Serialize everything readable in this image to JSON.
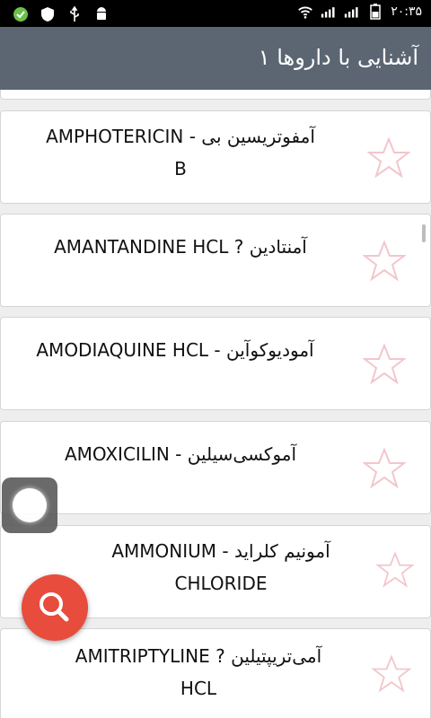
{
  "status_bar": {
    "time": "۲۰:۳۵"
  },
  "app_bar": {
    "title": "آشنایی با داروها ۱"
  },
  "drugs": [
    {
      "line1": "آمفوتریسین بی - AMPHOTERICIN",
      "line2": "B"
    },
    {
      "line1": "آمنتادین ? AMANTANDINE HCL",
      "line2": ""
    },
    {
      "line1": "آمودیوکوآین - AMODIAQUINE HCL",
      "line2": ""
    },
    {
      "line1": "آموکسی‌سیلین - AMOXICILIN",
      "line2": ""
    },
    {
      "line1": "آمونیم کلراید - AMMONIUM",
      "line2": "CHLORIDE"
    },
    {
      "line1": "آمی‌تریپتیلین ? AMITRIPTYLINE",
      "line2": "HCL"
    }
  ],
  "colors": {
    "app_bar": "#5b6672",
    "fab": "#e74c3c",
    "star_outline": "#f2c6cc"
  },
  "icons": {
    "fab": "search-icon",
    "favorite": "star-outline-icon"
  }
}
